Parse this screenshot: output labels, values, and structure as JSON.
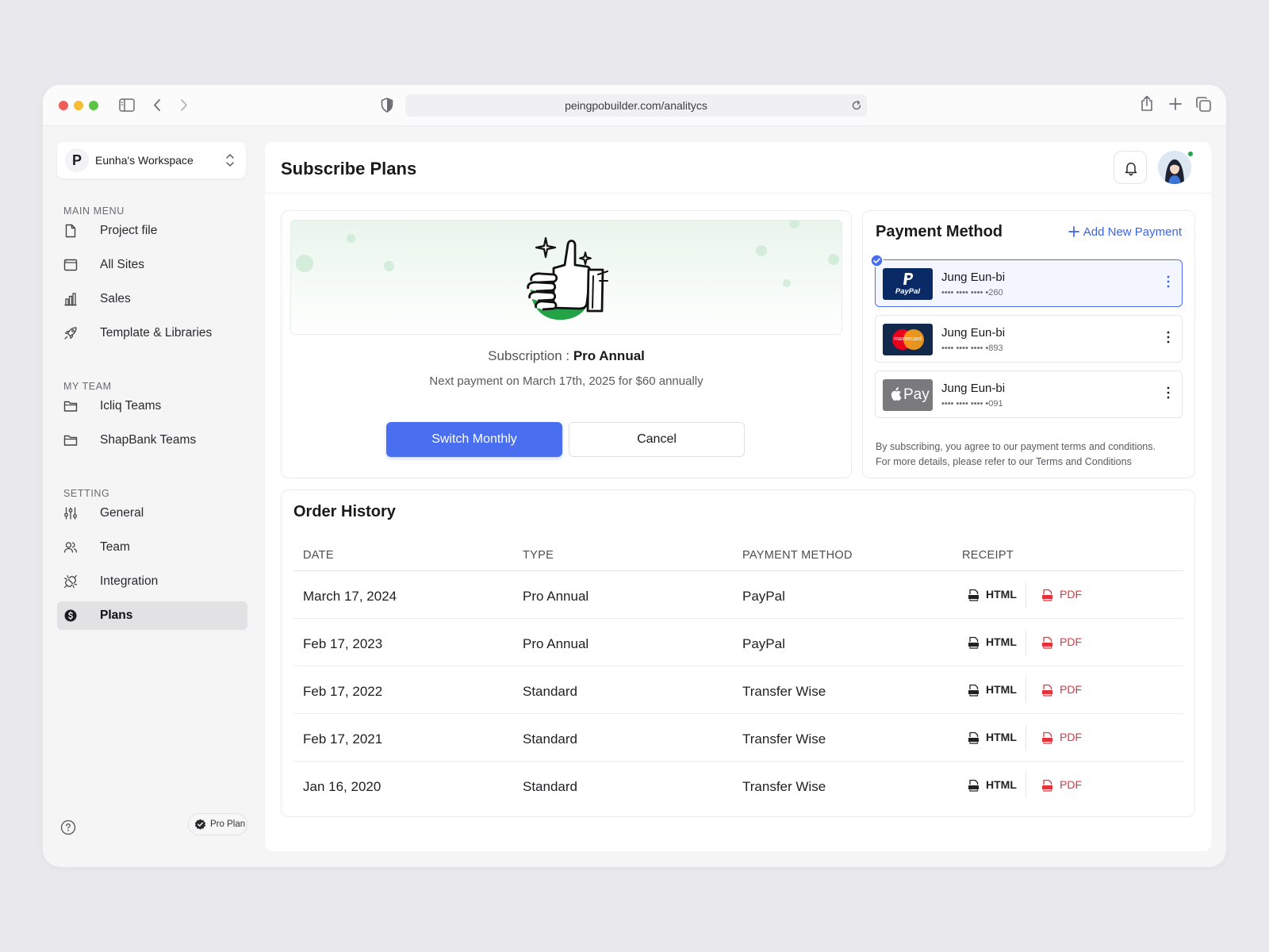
{
  "browser": {
    "url": "peingpobuilder.com/analitycs"
  },
  "workspace": {
    "logo": "P",
    "name": "Eunha's Workspace"
  },
  "sidebar": {
    "main_menu_title": "MAIN MENU",
    "main_menu": [
      {
        "label": "Project file",
        "icon": "file-icon"
      },
      {
        "label": "All Sites",
        "icon": "browser-window-icon"
      },
      {
        "label": "Sales",
        "icon": "bar-chart-icon"
      },
      {
        "label": "Template & Libraries",
        "icon": "rocket-icon"
      }
    ],
    "team_title": "MY TEAM",
    "teams": [
      {
        "label": "Icliq Teams",
        "icon": "folder-icon"
      },
      {
        "label": "ShapBank Teams",
        "icon": "folder-icon"
      }
    ],
    "setting_title": "SETTING",
    "settings": [
      {
        "label": "General",
        "icon": "sliders-icon"
      },
      {
        "label": "Team",
        "icon": "users-icon"
      },
      {
        "label": "Integration",
        "icon": "plug-icon"
      },
      {
        "label": "Plans",
        "icon": "dollar-circle-icon",
        "active": true
      }
    ],
    "plan_badge": "Pro Plan"
  },
  "header": {
    "title": "Subscribe Plans"
  },
  "subscription": {
    "label": "Subscription : ",
    "plan": "Pro Annual",
    "next_payment": "Next payment on March 17th, 2025 for $60 annually",
    "switch_label": "Switch Monthly",
    "cancel_label": "Cancel"
  },
  "payment": {
    "title": "Payment Method",
    "add_label": "Add New Payment",
    "methods": [
      {
        "brand": "PayPal",
        "name": "Jung Eun-bi",
        "number": "•••• •••• •••• •260",
        "selected": true
      },
      {
        "brand": "mastercard",
        "name": "Jung Eun-bi",
        "number": "•••• •••• •••• •893",
        "selected": false
      },
      {
        "brand": "Pay",
        "name": "Jung Eun-bi",
        "number": "•••• •••• •••• •091",
        "selected": false
      }
    ],
    "terms_line1": "By subscribing, you agree to our payment terms and conditions.",
    "terms_line2": "For more details, please refer to our Terms and Conditions"
  },
  "orders": {
    "title": "Order History",
    "columns": [
      "DATE",
      "TYPE",
      "PAYMENT METHOD",
      "RECEIPT"
    ],
    "html_label": "HTML",
    "pdf_label": "PDF",
    "rows": [
      {
        "date": "March 17, 2024",
        "type": "Pro Annual",
        "method": "PayPal"
      },
      {
        "date": "Feb 17, 2023",
        "type": "Pro Annual",
        "method": "PayPal"
      },
      {
        "date": "Feb 17, 2022",
        "type": "Standard",
        "method": "Transfer Wise"
      },
      {
        "date": "Feb 17, 2021",
        "type": "Standard",
        "method": "Transfer Wise"
      },
      {
        "date": "Jan 16, 2020",
        "type": "Standard",
        "method": "Transfer Wise"
      }
    ]
  },
  "colors": {
    "accent": "#4a6ef0",
    "success": "#22a447",
    "pdf": "#e3343e"
  }
}
